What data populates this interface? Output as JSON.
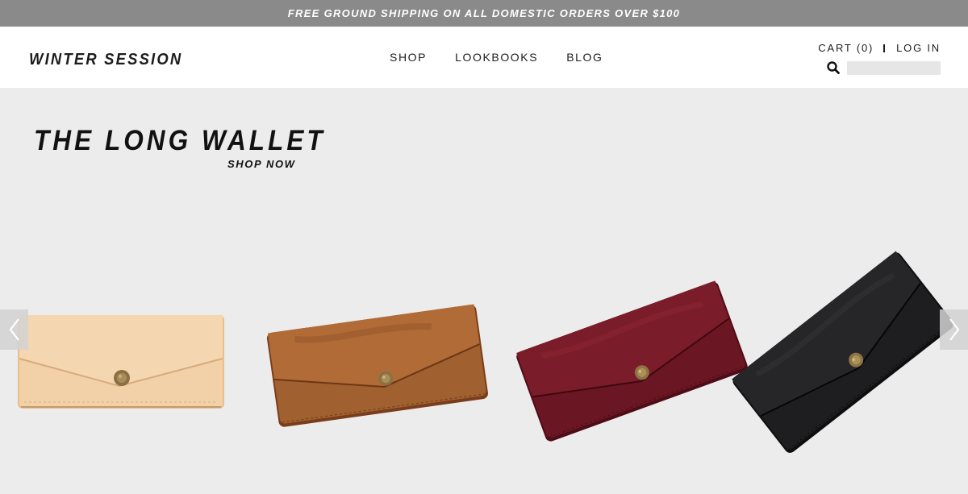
{
  "announcement": {
    "text": "FREE GROUND SHIPPING ON ALL DOMESTIC ORDERS OVER $100"
  },
  "header": {
    "logo": "WINTER SESSION",
    "nav": [
      {
        "label": "SHOP"
      },
      {
        "label": "LOOKBOOKS"
      },
      {
        "label": "BLOG"
      }
    ],
    "cart_label": "CART (0)",
    "login_label": "LOG IN",
    "search": {
      "icon": "search-icon",
      "value": "",
      "placeholder": ""
    }
  },
  "hero": {
    "title": "THE LONG WALLET",
    "cta": "SHOP NOW",
    "products": [
      {
        "name": "natural-leather-long-wallet",
        "color": "#f1cfa6"
      },
      {
        "name": "tan-brown-leather-long-wallet",
        "color": "#9e5a2f"
      },
      {
        "name": "burgundy-leather-long-wallet",
        "color": "#6a1522"
      },
      {
        "name": "black-leather-long-wallet",
        "color": "#1c1c1d"
      }
    ],
    "prev_icon": "chevron-left-icon",
    "next_icon": "chevron-right-icon"
  },
  "colors": {
    "announce_bg": "#8a8a8a",
    "hero_bg": "#ececec",
    "text": "#1c1c1c"
  }
}
